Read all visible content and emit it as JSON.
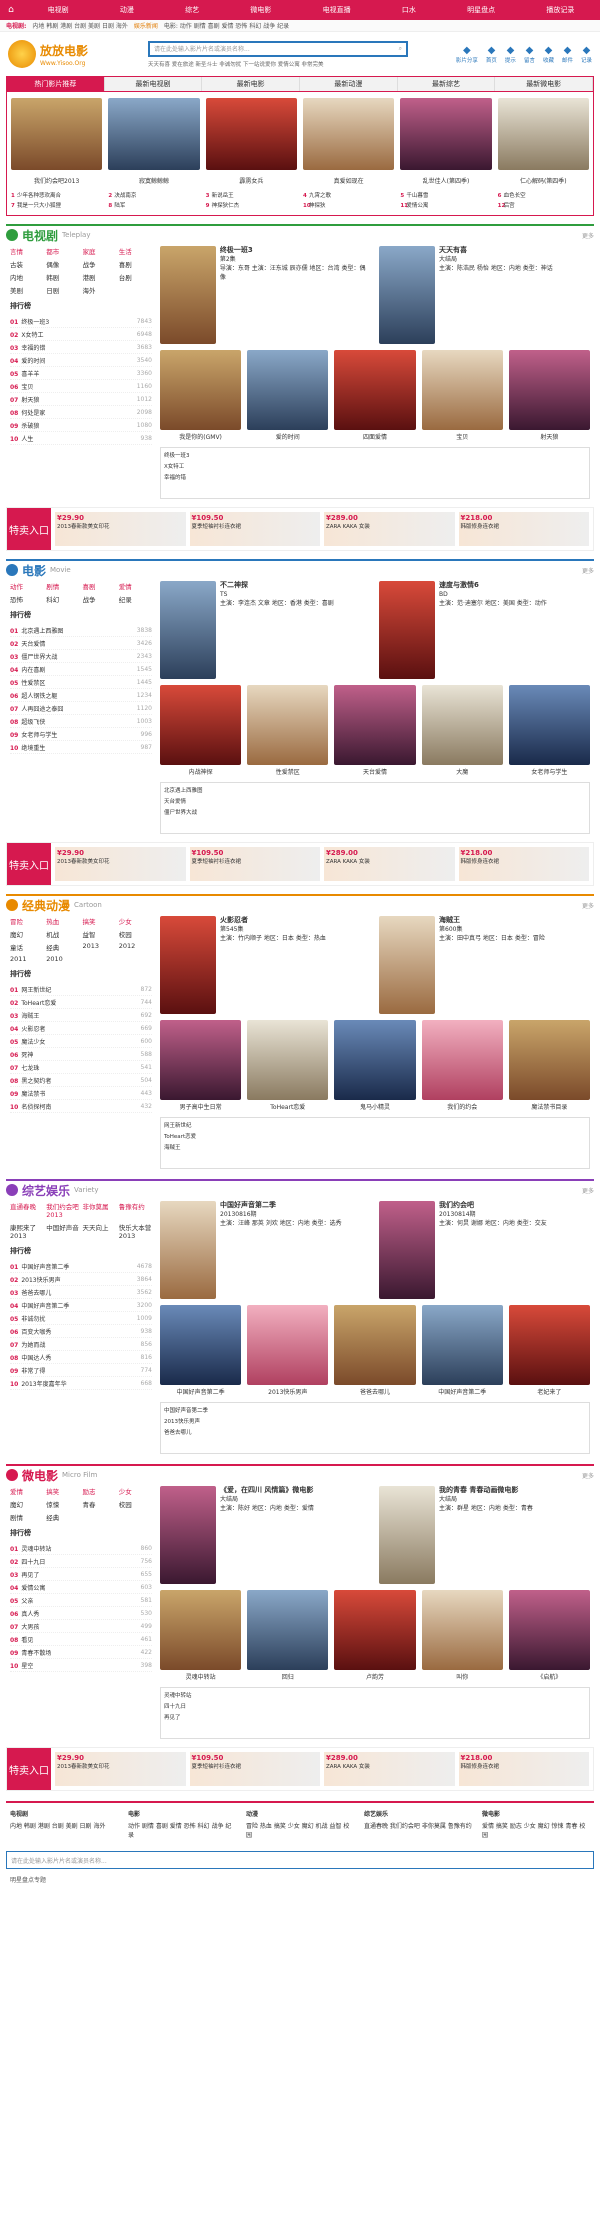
{
  "topnav": [
    "电视剧",
    "动漫",
    "综艺",
    "微电影",
    "电视直播",
    "口水",
    "明星盘点",
    "播放记录"
  ],
  "subnav": {
    "a": "电视剧:",
    "b": "内地 韩剧 港剧 台剧 美剧 日剧 海外",
    "c": "娱乐新闻",
    "d": "电影: 动作 剧情 喜剧 爱情 恐怖 科幻 战争 纪录"
  },
  "logo": {
    "name": "放放电影",
    "url": "Www.Yisoo.Org"
  },
  "search": {
    "placeholder": "请在此处输入影片片名或演员名称...",
    "hot": "天天有喜 爱在旅途 新圣斗士 非诚勿扰 下一站说爱你 爱情公寓 非常完美"
  },
  "tools": [
    "影片分享",
    "首页",
    "提示",
    "留言",
    "收藏",
    "邮件",
    "记录"
  ],
  "tabs": [
    "热门影片推荐",
    "最新电视剧",
    "最新电影",
    "最新动漫",
    "最新综艺",
    "最新微电影"
  ],
  "recommend": [
    "我们约会吧2013",
    "寂寞鲸鲸鲸",
    "霹雳女兵",
    "真爱如现在",
    "乱世佳人(第四季)",
    "仁心解码(第四季)"
  ],
  "hotlist": [
    [
      "1",
      "少年各种悲欢离合"
    ],
    [
      "2",
      "决战南京"
    ],
    [
      "3",
      "新说岳王"
    ],
    [
      "4",
      "九霄之歌"
    ],
    [
      "5",
      "千山暮雪"
    ],
    [
      "6",
      "血色长空"
    ],
    [
      "7",
      "我是一只大小狐狸"
    ],
    [
      "8",
      "陆军"
    ],
    [
      "9",
      "神探狄仁杰"
    ],
    [
      "10",
      "神探狄"
    ],
    [
      "11",
      "爱情公寓"
    ],
    [
      "12",
      "后宫"
    ]
  ],
  "tv": {
    "title": "电视剧",
    "en": "Teleplay",
    "more": "更多",
    "cats": [
      "言情",
      "都市",
      "家庭",
      "生活",
      "古装",
      "偶像",
      "战争",
      "喜剧",
      "内地",
      "韩剧",
      "港剧",
      "台剧",
      "美剧",
      "日剧",
      "海外"
    ],
    "rank_title": "排行榜",
    "rank": [
      [
        "01",
        "终极一班3",
        "7843"
      ],
      [
        "02",
        "X女特工",
        "6948"
      ],
      [
        "03",
        "幸福的错",
        "3683"
      ],
      [
        "04",
        "爱的时间",
        "3540"
      ],
      [
        "05",
        "喜羊羊",
        "3360"
      ],
      [
        "06",
        "宝贝",
        "1160"
      ],
      [
        "07",
        "射天狼",
        "1012"
      ],
      [
        "08",
        "何处是家",
        "2098"
      ],
      [
        "09",
        "杀破狼",
        "1080"
      ],
      [
        "10",
        "人生",
        "938"
      ]
    ],
    "feat": [
      {
        "t": "终极一班3",
        "s": "第2集",
        "d": "导演：东哥 主演：汪东城 辰亦儒 地区：台湾 类型：偶像"
      },
      {
        "t": "天天有喜",
        "s": "大结局",
        "d": "主演：陈浩民 杨怡 地区：内地 类型：神话"
      }
    ],
    "grid": [
      "我是你的(GMV)",
      "爱的时间",
      "四面爱情",
      "宝贝",
      "射天狼"
    ]
  },
  "movie": {
    "title": "电影",
    "en": "Movie",
    "more": "更多",
    "cats": [
      "动作",
      "剧情",
      "喜剧",
      "爱情",
      "恐怖",
      "科幻",
      "战争",
      "纪录"
    ],
    "rank_title": "排行榜",
    "rank": [
      [
        "01",
        "北京遇上西雅图",
        "3838"
      ],
      [
        "02",
        "天台爱情",
        "3426"
      ],
      [
        "03",
        "僵尸世界大战",
        "2343"
      ],
      [
        "04",
        "内在喜剧",
        "1545"
      ],
      [
        "05",
        "性爱禁区",
        "1445"
      ],
      [
        "06",
        "超人钢铁之躯",
        "1234"
      ],
      [
        "07",
        "人再囧途之泰囧",
        "1120"
      ],
      [
        "08",
        "超级飞侠",
        "1003"
      ],
      [
        "09",
        "女老师与学生",
        "996"
      ],
      [
        "10",
        "绝境重生",
        "987"
      ]
    ],
    "feat": [
      {
        "t": "不二神探",
        "s": "TS",
        "d": "主演：李连杰 文章 地区：香港 类型：喜剧"
      },
      {
        "t": "速度与激情6",
        "s": "BD",
        "d": "主演：范·迪塞尔 地区：美国 类型：动作"
      }
    ],
    "grid": [
      "内战神探",
      "性爱禁区",
      "天台爱情",
      "大魔",
      "女老师与学生"
    ]
  },
  "anime": {
    "title": "经典动漫",
    "en": "Cartoon",
    "more": "更多",
    "cats": [
      "冒险",
      "热血",
      "搞笑",
      "少女",
      "魔幻",
      "机战",
      "益智",
      "校园",
      "童话",
      "经典",
      "2013",
      "2012",
      "2011",
      "2010"
    ],
    "rank_title": "排行榜",
    "rank": [
      [
        "01",
        "网王新世纪",
        "872"
      ],
      [
        "02",
        "ToHeart恋爱",
        "744"
      ],
      [
        "03",
        "海贼王",
        "692"
      ],
      [
        "04",
        "火影忍者",
        "669"
      ],
      [
        "05",
        "魔法少女",
        "600"
      ],
      [
        "06",
        "死神",
        "588"
      ],
      [
        "07",
        "七龙珠",
        "541"
      ],
      [
        "08",
        "黑之契约者",
        "504"
      ],
      [
        "09",
        "魔法禁书",
        "443"
      ],
      [
        "10",
        "名侦探柯南",
        "432"
      ]
    ],
    "feat": [
      {
        "t": "火影忍者",
        "s": "第545集",
        "d": "主演：竹内顺子 地区：日本 类型：热血"
      },
      {
        "t": "海贼王",
        "s": "第600集",
        "d": "主演：田中真弓 地区：日本 类型：冒险"
      }
    ],
    "grid": [
      "男子高中生日常",
      "ToHeart恋爱",
      "鬼马小精灵",
      "我们的约会",
      "魔法禁书目录"
    ]
  },
  "variety": {
    "title": "综艺娱乐",
    "en": "Variety",
    "more": "更多",
    "cats": [
      "直通春晚",
      "我们约会吧2013",
      "非你莫属",
      "鲁豫有约",
      "康熙来了2013",
      "中国好声音",
      "天天向上",
      "快乐大本营2013"
    ],
    "rank_title": "排行榜",
    "rank": [
      [
        "01",
        "中国好声音第二季",
        "4678"
      ],
      [
        "02",
        "2013快乐男声",
        "3864"
      ],
      [
        "03",
        "爸爸去哪儿",
        "3562"
      ],
      [
        "04",
        "中国好声音第二季",
        "3200"
      ],
      [
        "05",
        "非诚勿扰",
        "1009"
      ],
      [
        "06",
        "百变大咖秀",
        "938"
      ],
      [
        "07",
        "为她而战",
        "856"
      ],
      [
        "08",
        "中国达人秀",
        "816"
      ],
      [
        "09",
        "非常了得",
        "774"
      ],
      [
        "10",
        "2013年度嘉年华",
        "668"
      ]
    ],
    "feat": [
      {
        "t": "中国好声音第二季",
        "s": "20130816期",
        "d": "主演：汪峰 那英 刘欢 地区：内地 类型：选秀"
      },
      {
        "t": "我们约会吧",
        "s": "20130814期",
        "d": "主演：何炅 谢娜 地区：内地 类型：交友"
      }
    ],
    "grid": [
      "中国好声音第二季",
      "2013快乐男声",
      "爸爸去哪儿",
      "中国好声音第二季",
      "老妃来了"
    ]
  },
  "micro": {
    "title": "微电影",
    "en": "Micro Film",
    "more": "更多",
    "cats": [
      "爱情",
      "搞笑",
      "励志",
      "少女",
      "魔幻",
      "惊悚",
      "青春",
      "校园",
      "剧情",
      "经典"
    ],
    "rank_title": "排行榜",
    "rank": [
      [
        "01",
        "灵魂中转站",
        "860"
      ],
      [
        "02",
        "四十九日",
        "756"
      ],
      [
        "03",
        "再见了",
        "655"
      ],
      [
        "04",
        "爱情公寓",
        "603"
      ],
      [
        "05",
        "父亲",
        "581"
      ],
      [
        "06",
        "真人秀",
        "530"
      ],
      [
        "07",
        "大男孩",
        "499"
      ],
      [
        "08",
        "看见",
        "461"
      ],
      [
        "09",
        "青春不散场",
        "422"
      ],
      [
        "10",
        "星空",
        "398"
      ]
    ],
    "feat": [
      {
        "t": "《爱，在四川 风情篇》微电影",
        "s": "大结局",
        "d": "主演：陈好 地区：内地 类型：爱情"
      },
      {
        "t": "我的青春 青春动画微电影",
        "s": "大结局",
        "d": "主演：群星 地区：内地 类型：青春"
      }
    ],
    "grid": [
      "灵魂中转站",
      "回归",
      "卢韵芳",
      "叫你",
      "《启航》"
    ]
  },
  "ads": [
    [
      "特卖入口",
      "29.90",
      "2013春新款美女印花"
    ],
    [
      "",
      "109.50",
      "夏季短袖衬衫连衣裙"
    ],
    [
      "",
      "289.00",
      "ZARA KAKA 女装"
    ],
    [
      "",
      "218.00",
      "韩版修身连衣裙"
    ]
  ],
  "footer": {
    "cols": [
      [
        "电视剧",
        "内地 韩剧 港剧 台剧 美剧 日剧 海外"
      ],
      [
        "电影",
        "动作 剧情 喜剧 爱情 恐怖 科幻 战争 纪录"
      ],
      [
        "动漫",
        "冒险 热血 搞笑 少女 魔幻 机战 益智 校园"
      ],
      [
        "综艺娱乐",
        "直通春晚 我们约会吧 非你莫属 鲁豫有约"
      ],
      [
        "微电影",
        "爱情 搞笑 励志 少女 魔幻 惊悚 青春 校园"
      ]
    ],
    "search_placeholder": "请在此处输入影片片名或演员名称...",
    "tag": "明星盘点专题"
  }
}
